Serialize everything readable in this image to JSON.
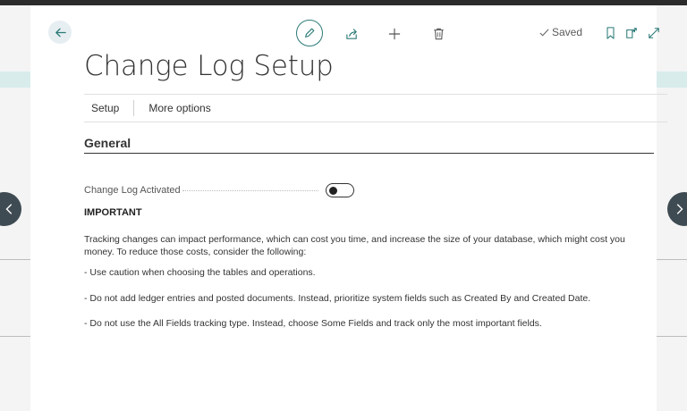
{
  "toolbar": {
    "saved_label": "Saved"
  },
  "page": {
    "title": "Change Log Setup"
  },
  "actions": {
    "setup": "Setup",
    "more_options": "More options"
  },
  "section": {
    "title": "General"
  },
  "field": {
    "label": "Change Log Activated",
    "value": false
  },
  "notice": {
    "heading": "IMPORTANT",
    "intro": "Tracking changes can impact performance, which can cost you time, and increase the size of your database, which might cost you money. To reduce those costs, consider the following:",
    "bullets": [
      "- Use caution when choosing the tables and operations.",
      "- Do not add ledger entries and posted documents. Instead, prioritize system fields such as Created By and Created Date.",
      "- Do not use the All Fields tracking type. Instead, choose Some Fields and track only the most important fields."
    ]
  },
  "colors": {
    "accent": "#2b7a77",
    "nav_arrow": "#3f4b53"
  }
}
